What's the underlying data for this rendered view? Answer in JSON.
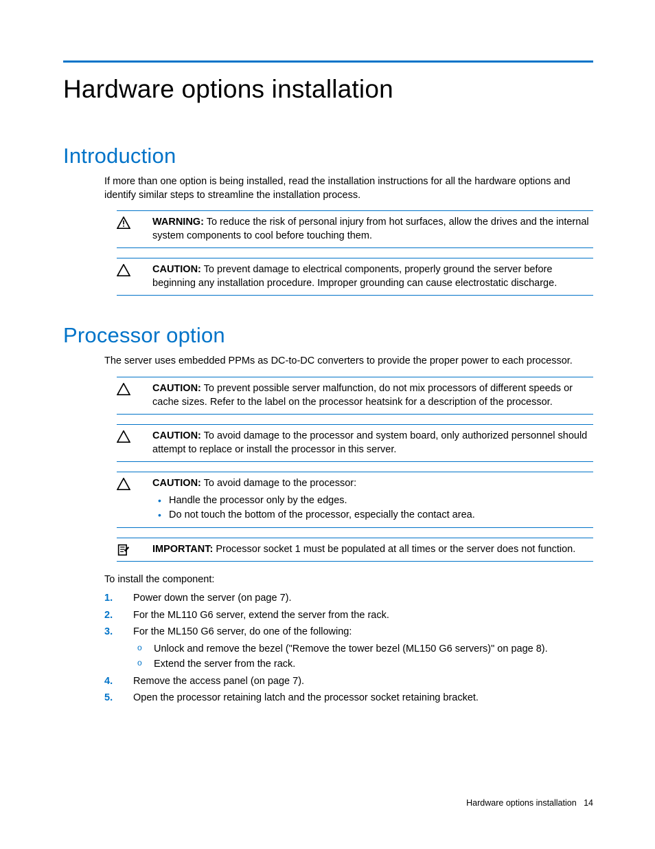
{
  "title": "Hardware options installation",
  "intro": {
    "heading": "Introduction",
    "text": "If more than one option is being installed, read the installation instructions for all the hardware options and identify similar steps to streamline the installation process.",
    "warning": {
      "label": "WARNING:",
      "text": "  To reduce the risk of personal injury from hot surfaces, allow the drives and the internal system components to cool before touching them."
    },
    "caution": {
      "label": "CAUTION:",
      "text": "  To prevent damage to electrical components, properly ground the server before beginning any installation procedure. Improper grounding can cause electrostatic discharge."
    }
  },
  "processor": {
    "heading": "Processor option",
    "text": "The server uses embedded PPMs as DC-to-DC converters to provide the proper power to each processor.",
    "caution1": {
      "label": "CAUTION:",
      "text": "  To prevent possible server malfunction, do not mix processors of different speeds or cache sizes. Refer to the label on the processor heatsink for a description of the processor."
    },
    "caution2": {
      "label": "CAUTION:",
      "text": "  To avoid damage to the processor and system board, only authorized personnel should attempt to replace or install the processor in this server."
    },
    "caution3": {
      "label": "CAUTION:",
      "text": "  To avoid damage to the processor:",
      "bullets": [
        "Handle the processor only by the edges.",
        "Do not touch the bottom of the processor, especially the contact area."
      ]
    },
    "important": {
      "label": "IMPORTANT:",
      "text": "  Processor socket 1 must be populated at all times or the server does not function."
    },
    "install_label": "To install the component:",
    "steps": [
      {
        "n": "1.",
        "t": "Power down the server (on page 7)."
      },
      {
        "n": "2.",
        "t": "For the ML110 G6 server, extend the server from the rack."
      },
      {
        "n": "3.",
        "t": "For the ML150 G6 server, do one of the following:",
        "subs": [
          "Unlock and remove the bezel (\"Remove the tower bezel (ML150 G6 servers)\" on page 8).",
          "Extend the server from the rack."
        ]
      },
      {
        "n": "4.",
        "t": "Remove the access panel (on page 7)."
      },
      {
        "n": "5.",
        "t": "Open the processor retaining latch and the processor socket retaining bracket."
      }
    ]
  },
  "footer": {
    "section": "Hardware options installation",
    "page": "14"
  }
}
